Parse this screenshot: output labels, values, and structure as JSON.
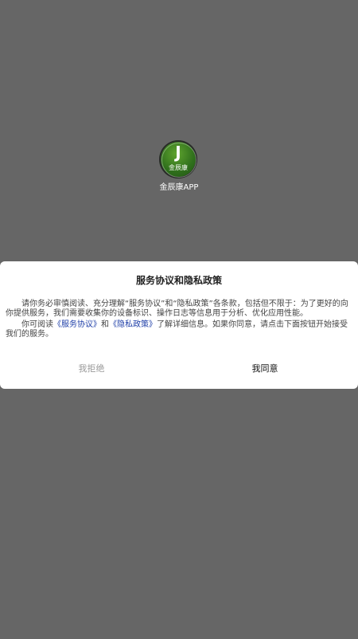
{
  "app": {
    "logo_letter": "J",
    "logo_text": "金辰康",
    "name": "金辰康APP"
  },
  "dialog": {
    "title": "服务协议和隐私政策",
    "para1": "请你务必审慎阅读、充分理解“服务协议”和“隐私政策”各条款，包括但不限于：为了更好的向你提供服务，我们需要收集你的设备标识、操作日志等信息用于分析、优化应用性能。",
    "para2_prefix": "你可阅读",
    "service_link": "《服务协议》",
    "para2_and": "和",
    "privacy_link": "《隐私政策》",
    "para2_suffix": "了解详细信息。如果你同意，请点击下面按钮开始接受我们的服务。",
    "reject_label": "我拒绝",
    "accept_label": "我同意"
  },
  "colors": {
    "overlay": "#666666",
    "dialog_bg": "#ffffff",
    "link": "#1f3fa8",
    "reject_text": "#999999",
    "accept_text": "#111111",
    "logo_green": "#2f6f1c"
  }
}
